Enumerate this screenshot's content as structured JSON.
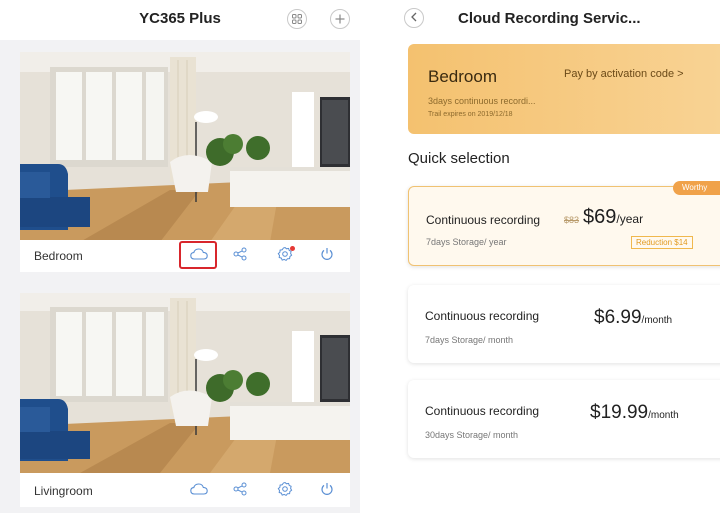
{
  "left": {
    "app_title": "YC365 Plus",
    "cameras": [
      {
        "name": "Bedroom",
        "has_alert": true,
        "cloud_highlighted": true
      },
      {
        "name": "Livingroom",
        "has_alert": false,
        "cloud_highlighted": false
      }
    ],
    "icons": [
      "grid-icon",
      "add-icon",
      "cloud-icon",
      "share-icon",
      "settings-icon",
      "power-icon"
    ]
  },
  "right": {
    "page_title": "Cloud Recording Servic...",
    "device": {
      "name": "Bedroom",
      "pay_link": "Pay by activation code >",
      "description": "3days continuous recordi...",
      "trial": "Trail expires on 2019/12/18"
    },
    "section_title": "Quick selection",
    "plans": [
      {
        "name": "Continuous recording",
        "storage": "7days Storage/ year",
        "old_price": "$83",
        "price": "$69",
        "unit": "/year",
        "reduction": "Reduction $14",
        "badge": "Worthy",
        "selected": true
      },
      {
        "name": "Continuous recording",
        "storage": "7days Storage/ month",
        "price": "$6.99",
        "unit": "/month",
        "selected": false
      },
      {
        "name": "Continuous recording",
        "storage": "30days Storage/ month",
        "price": "$19.99",
        "unit": "/month",
        "selected": false
      }
    ]
  },
  "colors": {
    "accent_gold": "#f4c16f",
    "badge_orange": "#f0a24a",
    "highlight_red": "#d8262c",
    "sofa_blue": "#1f4e8c"
  }
}
